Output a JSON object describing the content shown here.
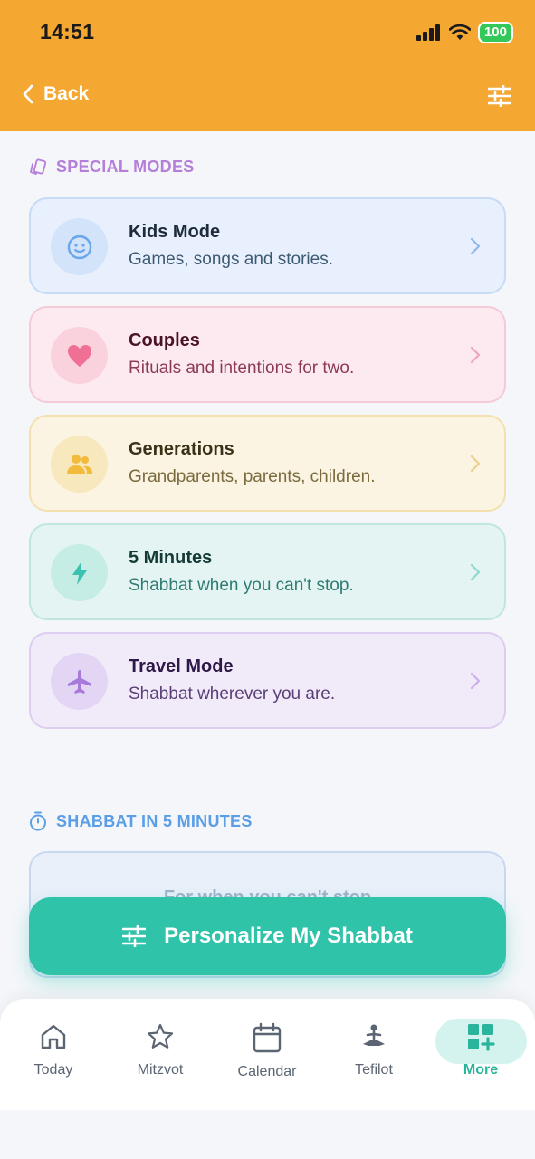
{
  "status": {
    "time": "14:51",
    "battery": "100"
  },
  "nav": {
    "back_label": "Back"
  },
  "special_modes": {
    "heading": "SPECIAL MODES",
    "cards": [
      {
        "title": "Kids Mode",
        "subtitle": "Games, songs and stories.",
        "icon": "smiley-face-icon",
        "color": "#6aa6ec"
      },
      {
        "title": "Couples",
        "subtitle": "Rituals and intentions for two.",
        "icon": "heart-icon",
        "color": "#f06f94"
      },
      {
        "title": "Generations",
        "subtitle": "Grandparents, parents, children.",
        "icon": "people-icon",
        "color": "#f2bb3c"
      },
      {
        "title": "5 Minutes",
        "subtitle": "Shabbat when you can't stop.",
        "icon": "lightning-icon",
        "color": "#3cc0b0"
      },
      {
        "title": "Travel Mode",
        "subtitle": "Shabbat wherever you are.",
        "icon": "airplane-icon",
        "color": "#a779da"
      }
    ]
  },
  "shabbat_5min": {
    "heading": "SHABBAT IN 5 MINUTES",
    "peek_text": "For when you can't stop"
  },
  "cta": {
    "label": "Personalize My Shabbat"
  },
  "tabs": [
    {
      "label": "Today",
      "icon": "home-icon"
    },
    {
      "label": "Mitzvot",
      "icon": "star-icon"
    },
    {
      "label": "Calendar",
      "icon": "calendar-icon"
    },
    {
      "label": "Tefilot",
      "icon": "prayer-person-icon"
    },
    {
      "label": "More",
      "icon": "grid-plus-icon",
      "active": true
    }
  ],
  "colors": {
    "header": "#f4a832",
    "accent": "#2fc3aa",
    "active_tab": "#2bb49c"
  }
}
